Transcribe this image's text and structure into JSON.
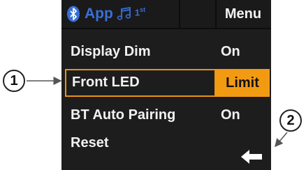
{
  "status_bar": {
    "app_label": "App",
    "position_label": "1",
    "position_suffix": "st",
    "menu_label": "Menu",
    "icons": [
      "bluetooth-icon",
      "music-note-icon"
    ],
    "accent_color": "#3a6fd8"
  },
  "menu": {
    "items": [
      {
        "label": "Display Dim",
        "value": "On"
      },
      {
        "label": "Front LED",
        "value": "Limit",
        "selected": true
      },
      {
        "label": "BT Auto Pairing",
        "value": "On"
      },
      {
        "label": "Reset",
        "value": ""
      }
    ],
    "selection_color": "#f39a13"
  },
  "back_icon": "back-arrow-icon",
  "callouts": {
    "one": "1",
    "two": "2"
  }
}
